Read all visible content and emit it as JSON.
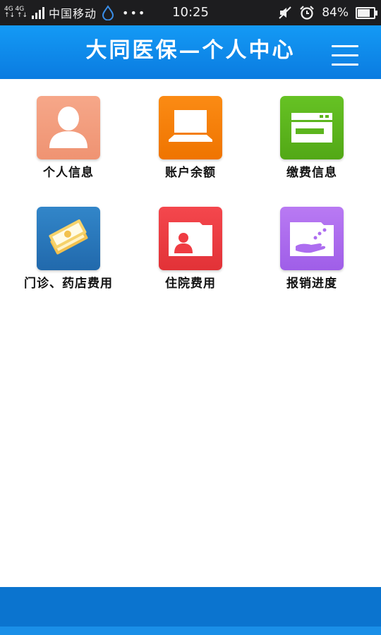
{
  "status_bar": {
    "network": "4G 4G",
    "carrier": "中国移动",
    "more": "•••",
    "time": "10:25",
    "battery": "84%"
  },
  "header": {
    "title": "大同医保—个人中心"
  },
  "colors": {
    "header": "#0a7be0",
    "personal": "#f39c7b",
    "balance": "#f27c05",
    "payment": "#5cb51d",
    "outpatient": "#2a79bd",
    "hospital": "#ef3c43",
    "progress": "#ad6df0"
  },
  "tiles": [
    {
      "label": "个人信息",
      "icon": "person-icon"
    },
    {
      "label": "账户余额",
      "icon": "laptop-icon"
    },
    {
      "label": "缴费信息",
      "icon": "card-icon"
    },
    {
      "label": "门诊、药店费用",
      "icon": "cash-icon"
    },
    {
      "label": "住院费用",
      "icon": "inpatient-icon"
    },
    {
      "label": "报销进度",
      "icon": "hand-icon"
    }
  ]
}
